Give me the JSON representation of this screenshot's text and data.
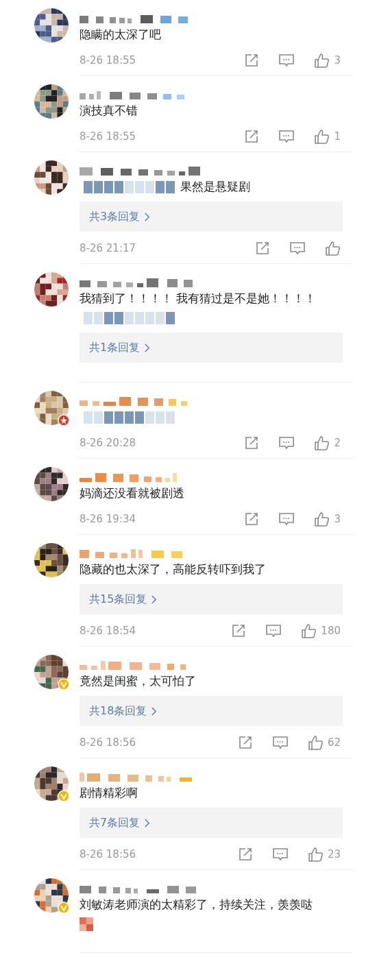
{
  "comments": [
    {
      "verified": false,
      "star_badge": false,
      "body": [
        {
          "kind": "text",
          "text": "隐瞒的太深了吧"
        }
      ],
      "time": "8-26 18:55",
      "likes": "3"
    },
    {
      "verified": false,
      "star_badge": false,
      "body": [
        {
          "kind": "text",
          "text": "演技真不错"
        }
      ],
      "time": "8-26 18:55",
      "likes": "1"
    },
    {
      "verified": false,
      "star_badge": false,
      "body": [
        {
          "kind": "blurred"
        },
        {
          "kind": "text",
          "text": "果然是悬疑剧"
        }
      ],
      "replies": "共3条回复",
      "time": "8-26 21:17"
    },
    {
      "verified": false,
      "star_badge": false,
      "body": [
        {
          "kind": "text",
          "text": "我猜到了！！！！ 我有猜过是不是她！！！！"
        },
        {
          "kind": "blurred"
        }
      ],
      "replies": "共1条回复"
    },
    {
      "verified": false,
      "star_badge": true,
      "body": [
        {
          "kind": "blurred"
        }
      ],
      "time": "8-26 20:28",
      "likes": "2"
    },
    {
      "verified": false,
      "star_badge": false,
      "body": [
        {
          "kind": "text",
          "text": "妈滴还没看就被剧透"
        }
      ],
      "time": "8-26 19:34",
      "likes": "3"
    },
    {
      "verified": false,
      "star_badge": false,
      "body": [
        {
          "kind": "text",
          "text": "隐藏的也太深了，高能反转吓到我了"
        }
      ],
      "replies": "共15条回复",
      "time": "8-26 18:54",
      "likes": "180"
    },
    {
      "verified": true,
      "star_badge": false,
      "body": [
        {
          "kind": "text",
          "text": "竟然是闺蜜，太可怕了"
        }
      ],
      "replies": "共18条回复",
      "time": "8-26 18:56",
      "likes": "62"
    },
    {
      "verified": true,
      "star_badge": false,
      "body": [
        {
          "kind": "text",
          "text": "剧情精彩啊"
        }
      ],
      "replies": "共7条回复",
      "time": "8-26 18:56",
      "likes": "23"
    },
    {
      "verified": true,
      "star_badge": false,
      "body": [
        {
          "kind": "text",
          "text": "刘敏涛老师演的太精彩了，持续关注，羡羡哒"
        },
        {
          "kind": "emoji"
        }
      ]
    }
  ]
}
